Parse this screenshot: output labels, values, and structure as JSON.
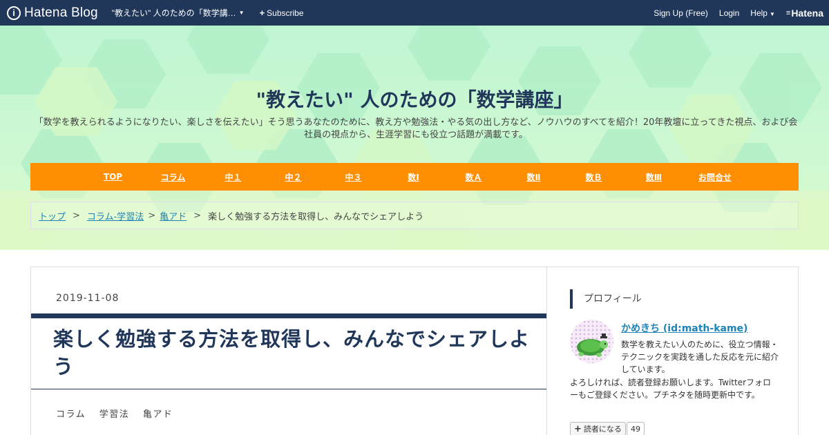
{
  "topbar": {
    "logo_text": "Hatena Blog",
    "blog_selector": "\"教えたい\" 人のための「数学講…",
    "subscribe": "Subscribe",
    "signup": "Sign Up (Free)",
    "login": "Login",
    "help": "Help",
    "brand": "Hatena",
    "bar_color": "#20375a"
  },
  "header": {
    "title": "\"教えたい\" 人のための「数学講座」",
    "description": "「数学を教えられるようになりたい、楽しさを伝えたい」そう思うあなたのために、教え方や勉強法・やる気の出し方など、ノウハウのすべてを紹介！20年教壇に立ってきた視点、および会社員の視点から、生涯学習にも役立つ話題が満載です。",
    "bg_color": "#c6f7d6"
  },
  "nav": {
    "color": "#ff8f00",
    "items": [
      {
        "label": "TOP"
      },
      {
        "label": "コラム"
      },
      {
        "label": "中１"
      },
      {
        "label": "中２"
      },
      {
        "label": "中３"
      },
      {
        "label": "数Ⅰ"
      },
      {
        "label": "数Ａ"
      },
      {
        "label": "数Ⅱ"
      },
      {
        "label": "数Ｂ"
      },
      {
        "label": "数Ⅲ"
      },
      {
        "label": "お問合せ"
      }
    ]
  },
  "breadcrumb": {
    "items": [
      "トップ",
      "コラム-学習法",
      "亀アド"
    ],
    "separator": ">",
    "current": "楽しく勉強する方法を取得し、みんなでシェアしよう"
  },
  "entry": {
    "date": "2019-11-08",
    "title": "楽しく勉強する方法を取得し、みんなでシェアしよう",
    "categories": [
      "コラム",
      "学習法",
      "亀アド"
    ]
  },
  "sidebar": {
    "heading": "プロフィール",
    "name": "かめきち (id:math-kame)",
    "bio": "数学を教えたい人のために、役立つ情報・テクニックを実践を通した反応を元に紹介しています。",
    "extra": "よろしければ、読者登録お願いします。Twitterフォローもご登録ください。プチネタを随時更新中です。",
    "reader_button": "読者になる",
    "reader_count": "49"
  }
}
